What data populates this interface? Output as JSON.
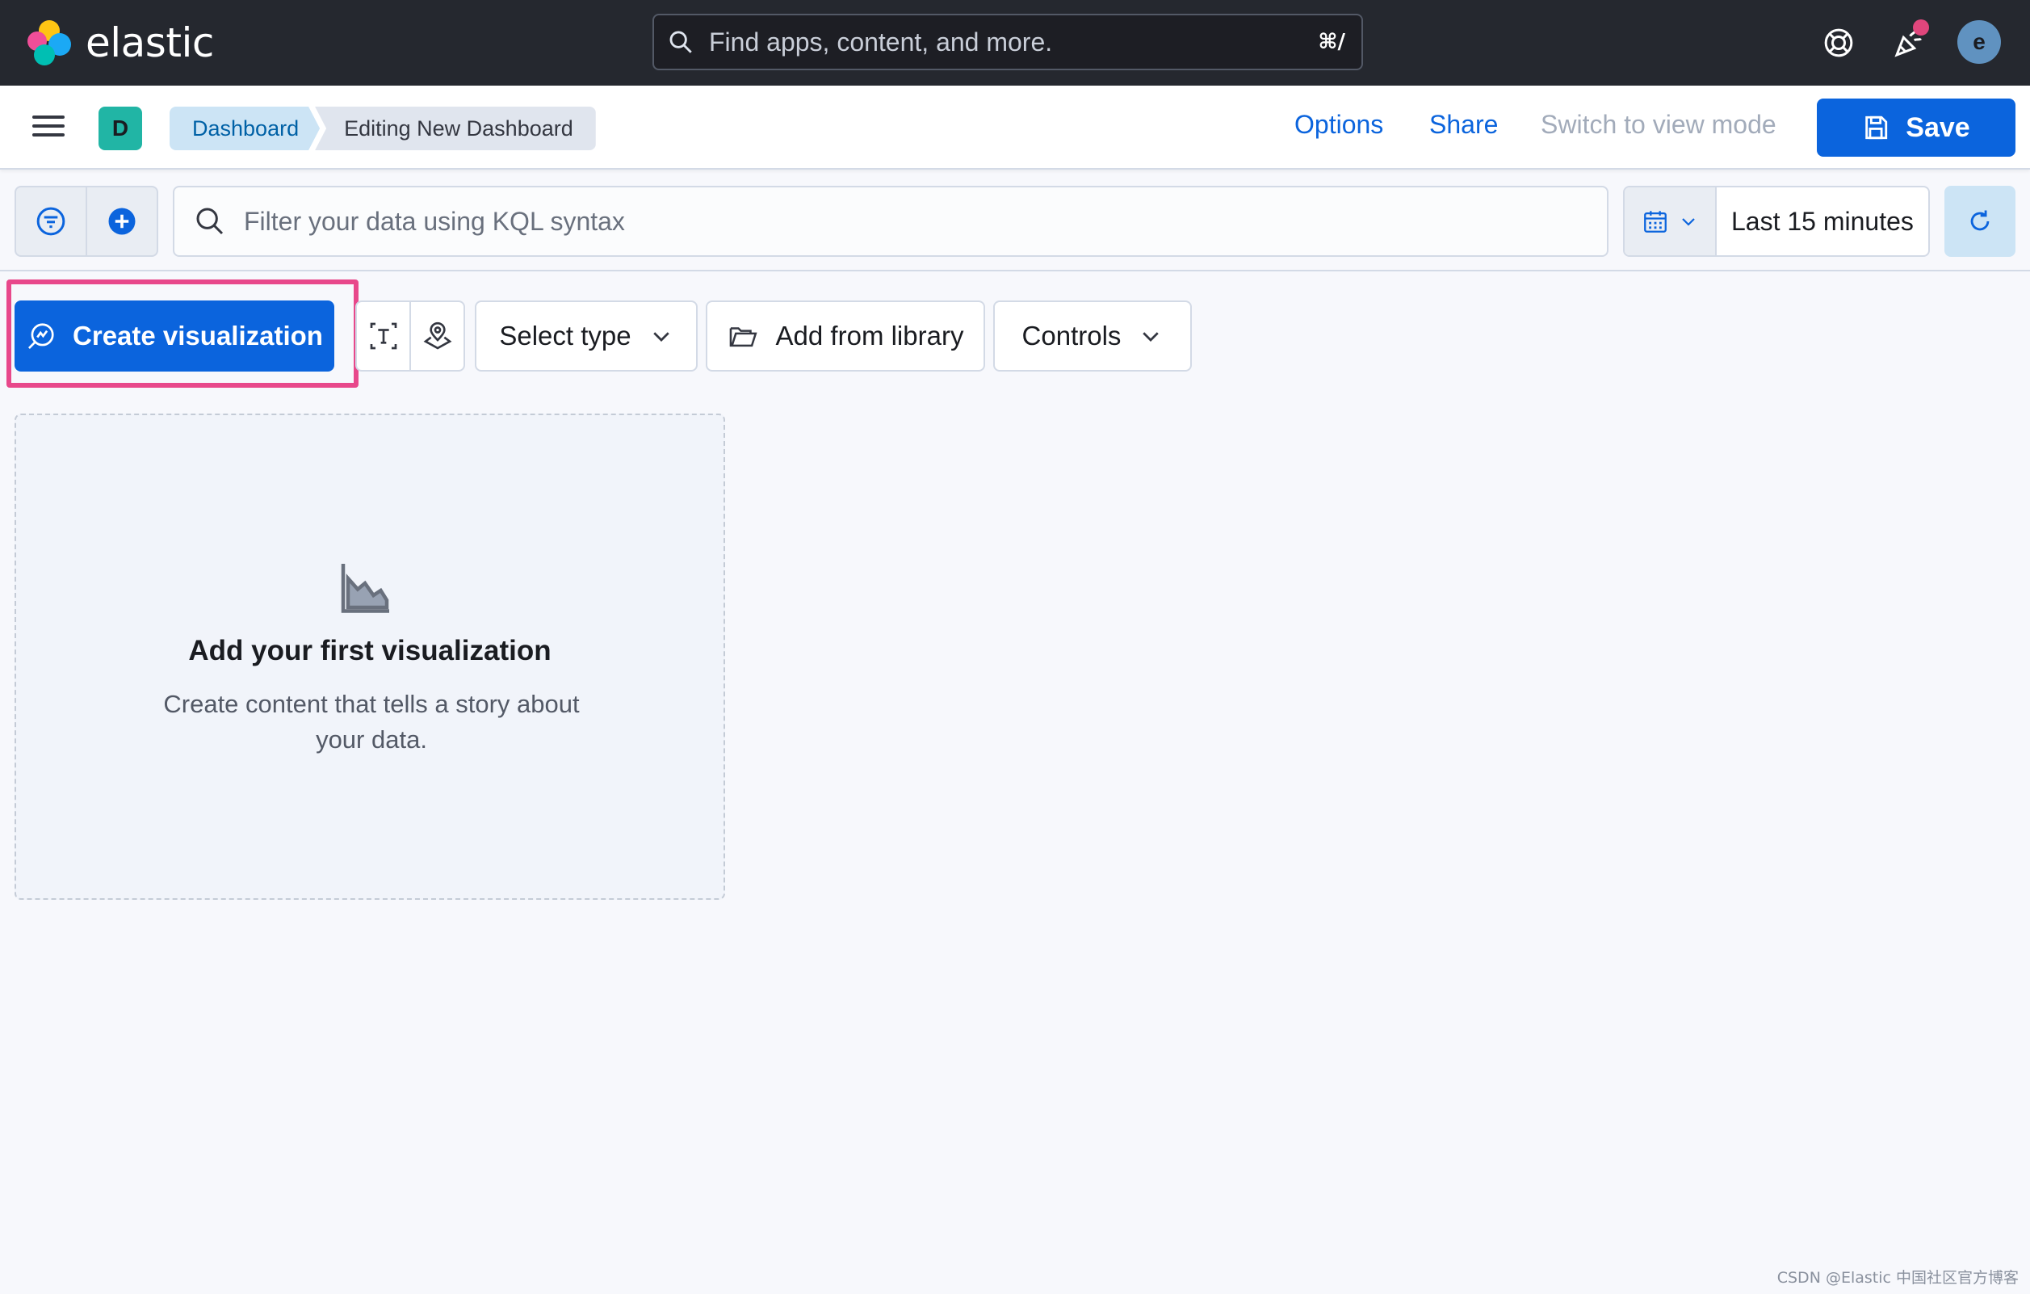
{
  "header": {
    "brand": "elastic",
    "search_placeholder": "Find apps, content, and more.",
    "search_shortcut": "⌘/",
    "avatar_initial": "e",
    "icons": [
      "help-icon",
      "newsfeed-icon"
    ]
  },
  "subheader": {
    "space_initial": "D",
    "breadcrumbs": [
      "Dashboard",
      "Editing New Dashboard"
    ],
    "options_label": "Options",
    "share_label": "Share",
    "switch_label": "Switch to view mode",
    "save_label": "Save"
  },
  "querybar": {
    "kql_placeholder": "Filter your data using KQL syntax",
    "time_range": "Last 15 minutes"
  },
  "toolbar": {
    "create_label": "Create visualization",
    "select_type_label": "Select type",
    "library_label": "Add from library",
    "controls_label": "Controls"
  },
  "empty_state": {
    "title": "Add your first visualization",
    "description": "Create content that tells a story about your data."
  },
  "watermark": "CSDN @Elastic 中国社区官方博客",
  "colors": {
    "header_bg": "#25282f",
    "primary": "#0b64dd",
    "highlight": "#e8488b",
    "space_badge": "#21b5a5",
    "avatar": "#6092c0"
  }
}
